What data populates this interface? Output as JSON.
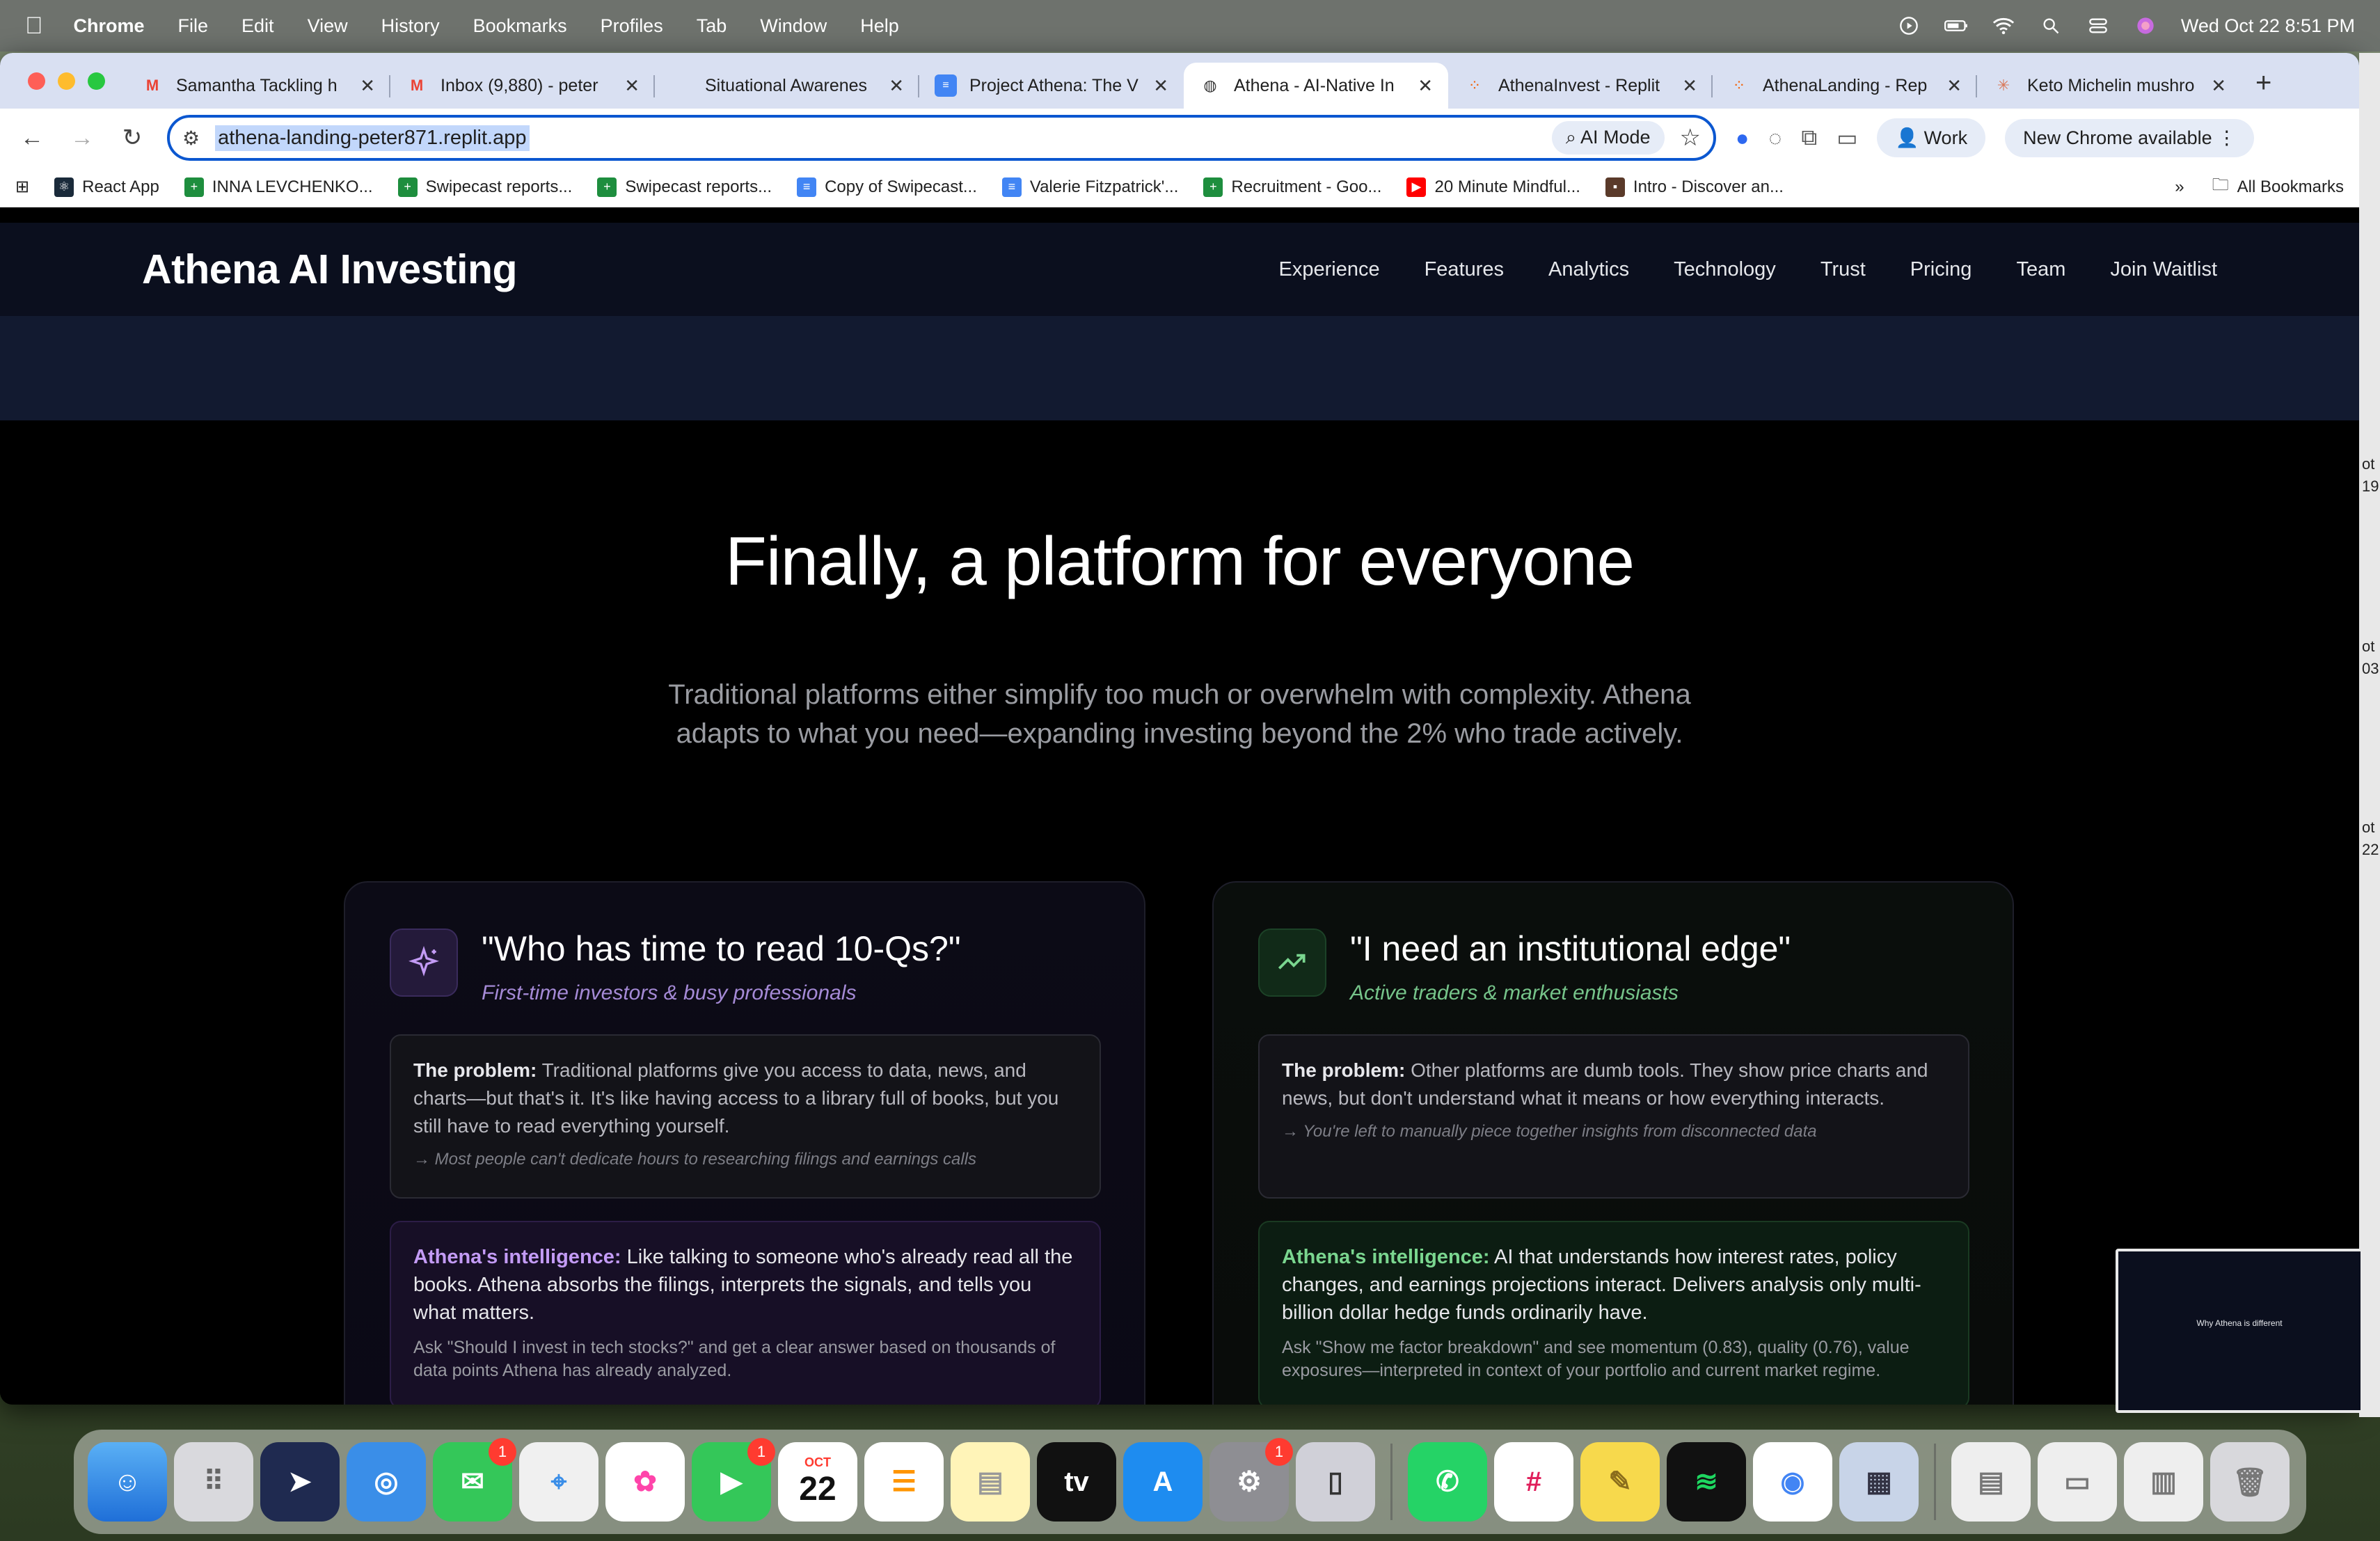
{
  "menubar": {
    "app": "Chrome",
    "items": [
      "File",
      "Edit",
      "View",
      "History",
      "Bookmarks",
      "Profiles",
      "Tab",
      "Window",
      "Help"
    ],
    "datetime": "Wed Oct 22  8:51 PM"
  },
  "tabs": [
    {
      "label": "Samantha Tackling h",
      "icon": "gmail-icon"
    },
    {
      "label": "Inbox (9,880) - peter",
      "icon": "gmail-icon"
    },
    {
      "label": "Situational Awarenes",
      "icon": "blank-icon"
    },
    {
      "label": "Project Athena: The V",
      "icon": "docs-icon"
    },
    {
      "label": "Athena - AI-Native In",
      "icon": "globe-icon",
      "active": true
    },
    {
      "label": "AthenaInvest - Replit",
      "icon": "replit-icon"
    },
    {
      "label": "AthenaLanding - Rep",
      "icon": "replit-icon"
    },
    {
      "label": "Keto Michelin mushro",
      "icon": "claude-icon"
    }
  ],
  "toolbar": {
    "url": "athena-landing-peter871.replit.app",
    "ai_mode": "AI Mode",
    "profile": "Work",
    "update": "New Chrome available"
  },
  "bookmarks": [
    {
      "label": "React App",
      "color": "#1a2a3a"
    },
    {
      "label": "INNA LEVCHENKO...",
      "color": "#1e8e3e"
    },
    {
      "label": "Swipecast reports...",
      "color": "#1e8e3e"
    },
    {
      "label": "Swipecast reports...",
      "color": "#1e8e3e"
    },
    {
      "label": "Copy of Swipecast...",
      "color": "#4285f4"
    },
    {
      "label": "Valerie Fitzpatrick'...",
      "color": "#4285f4"
    },
    {
      "label": "Recruitment - Goo...",
      "color": "#1e8e3e"
    },
    {
      "label": "20 Minute Mindful...",
      "color": "#ff0000"
    },
    {
      "label": "Intro - Discover an...",
      "color": "#5a3a2a"
    }
  ],
  "bookmarks_all": "All Bookmarks",
  "site": {
    "logo": "Athena AI Investing",
    "nav": [
      "Experience",
      "Features",
      "Analytics",
      "Technology",
      "Trust",
      "Pricing",
      "Team",
      "Join Waitlist"
    ],
    "hero_title": "Finally, a platform for everyone",
    "hero_sub": "Traditional platforms either simplify too much or overwhelm with complexity. Athena adapts to what you need—expanding investing beyond the 2% who trade actively."
  },
  "cards": [
    {
      "title": "\"Who has time to read 10-Qs?\"",
      "subtitle": "First-time investors & busy professionals",
      "problem_label": "The problem:",
      "problem_text": " Traditional platforms give you access to data, news, and charts—but that's it. It's like having access to a library full of books, but you still have to read everything yourself.",
      "problem_note": "→ Most people can't dedicate hours to researching filings and earnings calls",
      "intel_label": "Athena's intelligence:",
      "intel_text": " Like talking to someone who's already read all the books. Athena absorbs the filings, interprets the signals, and tells you what matters.",
      "intel_note": "Ask \"Should I invest in tech stocks?\" and get a clear answer based on thousands of data points Athena has already analyzed."
    },
    {
      "title": "\"I need an institutional edge\"",
      "subtitle": "Active traders & market enthusiasts",
      "problem_label": "The problem:",
      "problem_text": " Other platforms are dumb tools. They show price charts and news, but don't understand what it means or how everything interacts.",
      "problem_note": "→ You're left to manually piece together insights from disconnected data",
      "intel_label": "Athena's intelligence:",
      "intel_text": " AI that understands how interest rates, policy changes, and earnings projections interact. Delivers analysis only multi-billion dollar hedge funds ordinarily have.",
      "intel_note": "Ask \"Show me factor breakdown\" and see momentum (0.83), quality (0.76), value exposures—interpreted in context of your portfolio and current market regime."
    }
  ],
  "thumbnail": {
    "title": "Why Athena is different"
  },
  "dock": {
    "calendar_month": "OCT",
    "calendar_day": "22",
    "badges": {
      "messages": "1",
      "facetime": "1",
      "settings": "1"
    }
  },
  "edge": [
    "ot",
    "19",
    "ot",
    "03",
    "ot",
    "22"
  ]
}
